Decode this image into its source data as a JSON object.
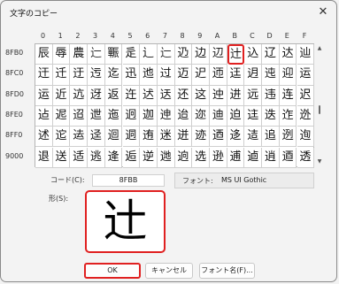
{
  "window": {
    "title": "文字のコピー",
    "close_glyph": "✕"
  },
  "columns": [
    "0",
    "1",
    "2",
    "3",
    "4",
    "5",
    "6",
    "7",
    "8",
    "9",
    "A",
    "B",
    "C",
    "D",
    "E",
    "F"
  ],
  "rows": [
    {
      "code": "8FB0",
      "chars": [
        "辰",
        "辱",
        "農",
        "辷",
        "辴",
        "辵",
        "辶",
        "辷",
        "辸",
        "边",
        "辺",
        "辻",
        "込",
        "辽",
        "达",
        "辿"
      ]
    },
    {
      "code": "8FC0",
      "chars": [
        "迀",
        "迁",
        "迂",
        "迃",
        "迄",
        "迅",
        "迆",
        "过",
        "迈",
        "迉",
        "迊",
        "迋",
        "迌",
        "迍",
        "迎",
        "运"
      ]
    },
    {
      "code": "8FD0",
      "chars": [
        "运",
        "近",
        "迒",
        "迓",
        "返",
        "迕",
        "迖",
        "迗",
        "还",
        "这",
        "迚",
        "进",
        "远",
        "违",
        "连",
        "迟"
      ]
    },
    {
      "code": "8FE0",
      "chars": [
        "迠",
        "迡",
        "迢",
        "迣",
        "迤",
        "迥",
        "迦",
        "迧",
        "迨",
        "迩",
        "迪",
        "迫",
        "迬",
        "迭",
        "迮",
        "迯"
      ]
    },
    {
      "code": "8FF0",
      "chars": [
        "述",
        "迱",
        "迲",
        "迳",
        "迴",
        "迵",
        "迶",
        "迷",
        "迸",
        "迹",
        "迺",
        "迻",
        "迼",
        "追",
        "迾",
        "迿"
      ]
    },
    {
      "code": "9000",
      "chars": [
        "退",
        "送",
        "适",
        "逃",
        "逄",
        "逅",
        "逆",
        "逇",
        "逈",
        "选",
        "逊",
        "逋",
        "逌",
        "逍",
        "逎",
        "透"
      ]
    }
  ],
  "selected": {
    "row": 0,
    "col": 11
  },
  "code_label": "コード(C):",
  "code_value": "8FBB",
  "font_label": "フォント:",
  "font_value": "MS UI Gothic",
  "shape_label": "形(S):",
  "preview_char": "辻",
  "buttons": {
    "ok": "OK",
    "cancel": "キャンセル",
    "font_name": "フォント名(F)..."
  },
  "scroll": {
    "up": "▲",
    "down": "▼"
  }
}
